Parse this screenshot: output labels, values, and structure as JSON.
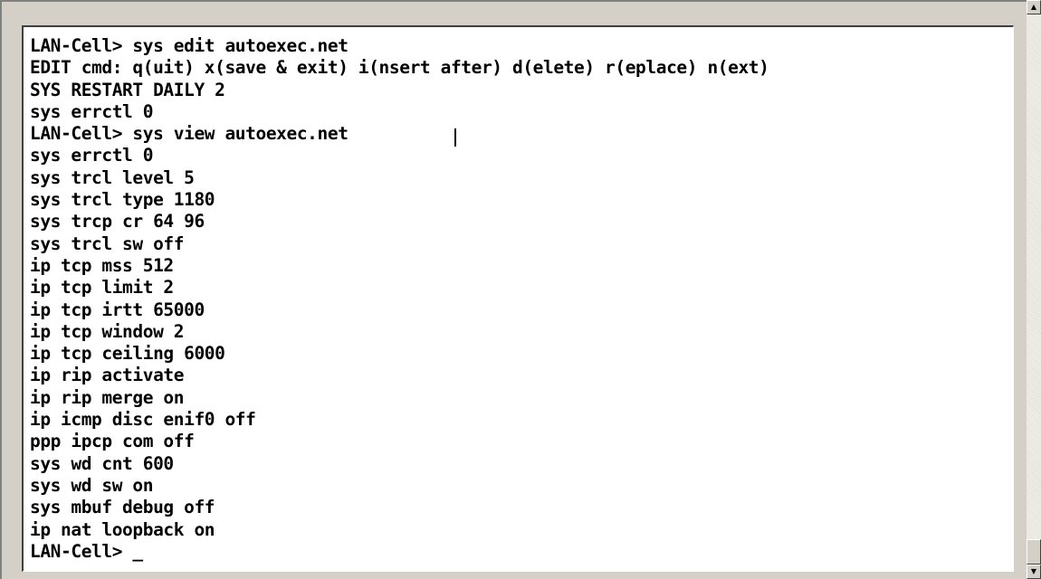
{
  "terminal": {
    "lines": [
      "LAN-Cell> sys edit autoexec.net",
      "EDIT cmd: q(uit) x(save & exit) i(nsert after) d(elete) r(eplace) n(ext)",
      "SYS RESTART DAILY 2",
      "sys errctl 0",
      "LAN-Cell> sys view autoexec.net",
      "sys errctl 0",
      "sys trcl level 5",
      "sys trcl type 1180",
      "sys trcp cr 64 96",
      "sys trcl sw off",
      "ip tcp mss 512",
      "ip tcp limit 2",
      "ip tcp irtt 65000",
      "ip tcp window 2",
      "ip tcp ceiling 6000",
      "ip rip activate",
      "ip rip merge on",
      "ip icmp disc enif0 off",
      "ppp ipcp com off",
      "sys wd cnt 600",
      "sys wd sw on",
      "sys mbuf debug off",
      "ip nat loopback on",
      "LAN-Cell> _"
    ]
  },
  "scrollbar": {
    "up_icon": "up-arrow-icon",
    "down_icon": "down-arrow-icon",
    "up_glyph": "▲",
    "down_glyph": "▼"
  },
  "colors": {
    "background": "#d4d0c8",
    "screen": "#ffffff",
    "text": "#000000"
  }
}
